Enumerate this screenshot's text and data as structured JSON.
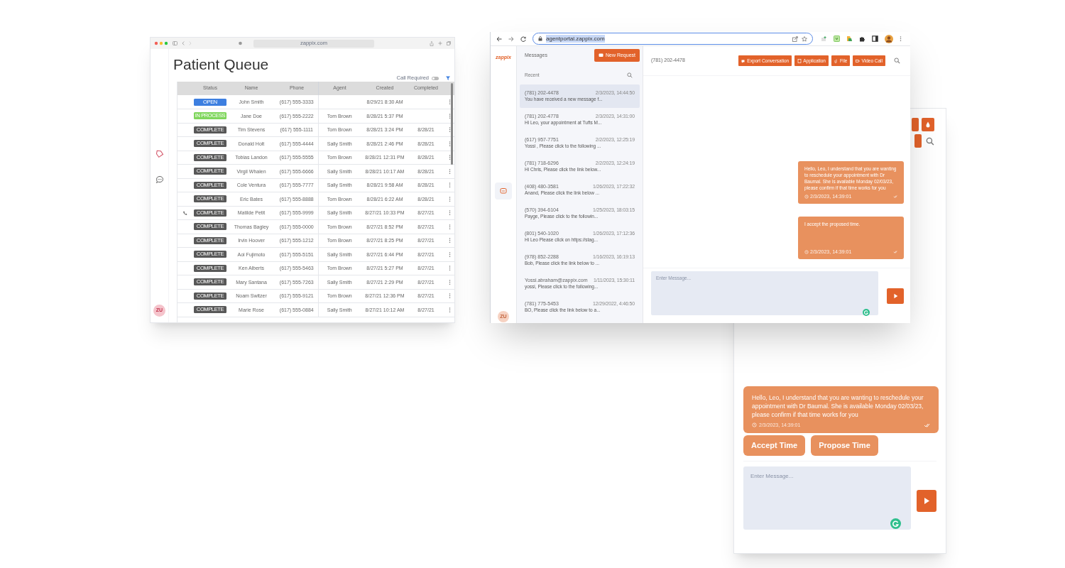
{
  "patient_queue": {
    "url": "zappix.com",
    "title": "Patient Queue",
    "call_required": {
      "label": "Call Required",
      "on": false
    },
    "columns": [
      "Status",
      "Name",
      "Phone",
      "Agent",
      "Created",
      "Completed"
    ],
    "rows": [
      {
        "status": "OPEN",
        "kind": "open",
        "name": "John Smith",
        "phone": "(617) 555-3333",
        "created": "8/29/21 8:30 AM",
        "call": false
      },
      {
        "status": "IN PROCESS",
        "kind": "in_process",
        "name": "Jane Doe",
        "phone": "(617) 555-2222",
        "agent": "Tom Brown",
        "created": "8/28/21 5:37 PM",
        "call": false
      },
      {
        "status": "COMPLETE",
        "kind": "complete",
        "name": "Tim Stevens",
        "phone": "(617) 555-1111",
        "agent": "Tom Brown",
        "created": "8/28/21 3:24 PM",
        "completed": "8/28/21",
        "call": false
      },
      {
        "status": "COMPLETE",
        "kind": "complete",
        "name": "Donald Holt",
        "phone": "(617) 555-4444",
        "agent": "Sally Smith",
        "created": "8/28/21 2:46 PM",
        "completed": "8/28/21",
        "call": false
      },
      {
        "status": "COMPLETE",
        "kind": "complete",
        "name": "Tobias Landon",
        "phone": "(617) 555-5555",
        "agent": "Tom Brown",
        "created": "8/28/21 12:31 PM",
        "completed": "8/28/21",
        "call": false
      },
      {
        "status": "COMPLETE",
        "kind": "complete",
        "name": "Virgil Whalen",
        "phone": "(617) 555-6666",
        "agent": "Sally Smith",
        "created": "8/28/21 10:17 AM",
        "completed": "8/28/21",
        "call": false
      },
      {
        "status": "COMPLETE",
        "kind": "complete",
        "name": "Cole Ventura",
        "phone": "(617) 555-7777",
        "agent": "Sally Smith",
        "created": "8/28/21 9:58 AM",
        "completed": "8/28/21",
        "call": false
      },
      {
        "status": "COMPLETE",
        "kind": "complete",
        "name": "Eric Bates",
        "phone": "(617) 555-8888",
        "agent": "Tom Brown",
        "created": "8/28/21 6:22 AM",
        "completed": "8/28/21",
        "call": false
      },
      {
        "status": "COMPLETE",
        "kind": "complete",
        "name": "Matilde Petit",
        "phone": "(617) 555-9999",
        "agent": "Sally Smith",
        "created": "8/27/21 10:33 PM",
        "completed": "8/27/21",
        "call": true
      },
      {
        "status": "COMPLETE",
        "kind": "complete",
        "name": "Thomas Bagley",
        "phone": "(617) 555-0000",
        "agent": "Tom Brown",
        "created": "8/27/21 8:52 PM",
        "completed": "8/27/21",
        "call": false
      },
      {
        "status": "COMPLETE",
        "kind": "complete",
        "name": "Irvin Hoover",
        "phone": "(617) 555-1212",
        "agent": "Tom Brown",
        "created": "8/27/21 8:25 PM",
        "completed": "8/27/21",
        "call": false
      },
      {
        "status": "COMPLETE",
        "kind": "complete",
        "name": "Aoi Fujimoto",
        "phone": "(617) 555-5151",
        "agent": "Sally Smith",
        "created": "8/27/21 6:44 PM",
        "completed": "8/27/21",
        "call": false
      },
      {
        "status": "COMPLETE",
        "kind": "complete",
        "name": "Ken Alberts",
        "phone": "(617) 555-5463",
        "agent": "Tom Brown",
        "created": "8/27/21 5:27 PM",
        "completed": "8/27/21",
        "call": false
      },
      {
        "status": "COMPLETE",
        "kind": "complete",
        "name": "Mary Santana",
        "phone": "(617) 555-7263",
        "agent": "Sally Smith",
        "created": "8/27/21 2:29 PM",
        "completed": "8/27/21",
        "call": false
      },
      {
        "status": "COMPLETE",
        "kind": "complete",
        "name": "Noam Switzer",
        "phone": "(617) 555-9121",
        "agent": "Tom Brown",
        "created": "8/27/21 12:36 PM",
        "completed": "8/27/21",
        "call": false
      },
      {
        "status": "COMPLETE",
        "kind": "complete",
        "name": "Marie Rose",
        "phone": "(617) 555-0884",
        "agent": "Sally Smith",
        "created": "8/27/21 10:12 AM",
        "completed": "8/27/21",
        "call": false
      }
    ],
    "avatar": "ZU"
  },
  "agent_portal": {
    "url": "agentportal.zappix.com",
    "logo": "zappix",
    "messages_title": "Messages",
    "new_request": "New Request",
    "recent": "Recent",
    "conversations": [
      {
        "contact": "(781) 202-4478",
        "time": "2/3/2023, 14:44:50",
        "preview": "You have received a new message f...",
        "selected": true
      },
      {
        "contact": "(781) 202-4778",
        "time": "2/3/2023, 14:31:00",
        "preview": "Hi Leo, your appointment at Tufts M...",
        "selected": false
      },
      {
        "contact": "(617) 957-7751",
        "time": "2/2/2023, 12:25:19",
        "preview": "Yossi , Please click to the following ...",
        "selected": false
      },
      {
        "contact": "(781) 718-6296",
        "time": "2/2/2023, 12:24:19",
        "preview": "Hi Chris, Please click the link below...",
        "selected": false
      },
      {
        "contact": "(408) 480-3581",
        "time": "1/26/2023, 17:22:32",
        "preview": "Anand, Please click the link below ...",
        "selected": false
      },
      {
        "contact": "(570) 394-6104",
        "time": "1/25/2023, 18:03:15",
        "preview": "Payge, Please click to the followin...",
        "selected": false
      },
      {
        "contact": "(801) 540-1020",
        "time": "1/26/2023, 17:12:36",
        "preview": "Hi Leo Please click on https://stag...",
        "selected": false
      },
      {
        "contact": "(978) 852-2288",
        "time": "1/16/2023, 16:19:13",
        "preview": "Bob, Please click the link below to ...",
        "selected": false
      },
      {
        "contact": "Yossi.abraham@zappix.com",
        "time": "1/11/2023, 15:30:11",
        "preview": "yossi, Please click to the following...",
        "selected": false
      },
      {
        "contact": "(781) 775-5453",
        "time": "12/29/2022, 4:46:50",
        "preview": "BO, Please click the link below to a...",
        "selected": false
      }
    ],
    "avatar": "ZU",
    "contact": "(781) 202-4478",
    "actions": [
      "Export Conversation",
      "Application",
      "File",
      "Video Call"
    ],
    "messages": [
      {
        "text": "Hello, Leo, I understand that you are wanting to reschedule your appointment with Dr Baumal. She is available Monday 02/03/23, please confirm if that time works for you",
        "time": "2/3/2023, 14:39:01"
      },
      {
        "text": "I accept the proposed time.",
        "time": "2/3/2023, 14:39:01"
      }
    ],
    "input_placeholder": "Enter Message..."
  },
  "mobile_chat": {
    "messages": [
      {
        "text": "Hello, Leo, I understand that you are wanting to reschedule your appointment with Dr Baumal. She is available Monday 02/03/23, please confirm if that time works for you",
        "time": "2/3/2023, 14:39:01"
      }
    ],
    "quick_replies": [
      "Accept Time",
      "Propose Time"
    ],
    "input_placeholder": "Enter Message..."
  }
}
